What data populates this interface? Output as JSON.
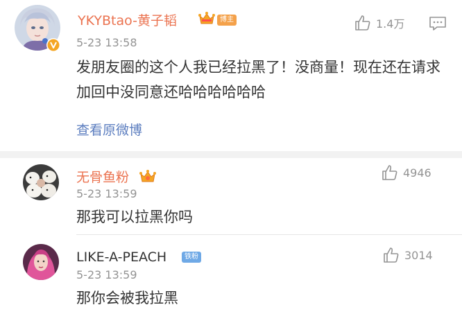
{
  "main_comment": {
    "username": "YKYBtao-黄子韬",
    "badge_icon": "crown-icon",
    "tag": "博主",
    "timestamp": "5-23 13:58",
    "like_count": "1.4万",
    "content": "发朋友圈的这个人我已经拉黑了！没商量！现在还在请求加回中没同意还哈哈哈哈哈哈",
    "view_original": "查看原微博",
    "verified_color": "#f5a623",
    "name_color": "#eb7350"
  },
  "replies": [
    {
      "username": "无骨鱼粉",
      "badge_icon": "fan-crown-icon",
      "timestamp": "5-23 13:59",
      "like_count": "4946",
      "content": "那我可以拉黑你吗"
    },
    {
      "username": "LIKE-A-PEACH",
      "tag": "铁粉",
      "timestamp": "5-23 13:59",
      "like_count": "3014",
      "content": "那你会被我拉黑"
    }
  ]
}
